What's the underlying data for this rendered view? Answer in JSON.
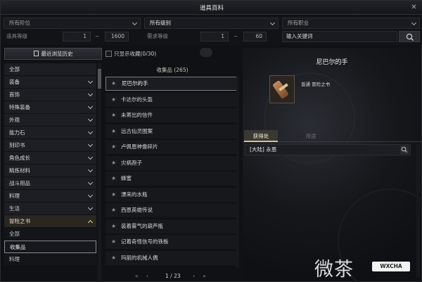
{
  "window": {
    "title": "道具百科"
  },
  "filters": {
    "part": "所有阶位",
    "grade": "所有级别",
    "job": "所有职业",
    "item_level_label": "道具等级",
    "item_level_min": "1",
    "item_level_max": "1600",
    "req_level_label": "需求等级",
    "req_level_min": "1",
    "req_level_max": "60",
    "range_sep": "~",
    "keyword_placeholder": "输入关键词"
  },
  "sidebar": {
    "recent_label": "最近浏览历史",
    "categories": [
      {
        "label": "全部"
      },
      {
        "label": "装备"
      },
      {
        "label": "首饰"
      },
      {
        "label": "特殊装备"
      },
      {
        "label": "外观"
      },
      {
        "label": "能力石"
      },
      {
        "label": "刻印书"
      },
      {
        "label": "角色成长"
      },
      {
        "label": "精炼材料"
      },
      {
        "label": "战斗用品"
      },
      {
        "label": "料理"
      },
      {
        "label": "生活"
      },
      {
        "label": "冒险之书"
      }
    ],
    "subcategories": [
      {
        "label": "全部"
      },
      {
        "label": "收集品"
      },
      {
        "label": "料理"
      }
    ]
  },
  "list": {
    "favorites_only_label": "只显示收藏(0/30)",
    "header": "收集品 (265)",
    "items": [
      {
        "name": "尼巴尔的手"
      },
      {
        "name": "卡达尔的头盔"
      },
      {
        "name": "未寄出的信件"
      },
      {
        "name": "远古仙灵图案"
      },
      {
        "name": "卢佩恩神像碎片"
      },
      {
        "name": "灾祸孢子"
      },
      {
        "name": "蜂蜜"
      },
      {
        "name": "漂来的水瓶"
      },
      {
        "name": "西恩英雄传说"
      },
      {
        "name": "装着雾气的葫芦瓶"
      },
      {
        "name": "记着奇怪信号的铁板"
      },
      {
        "name": "玛丽的机械人偶"
      }
    ],
    "page": "1 / 23",
    "nav": {
      "first": "«",
      "prev": "‹",
      "next": "›",
      "last": "»"
    }
  },
  "detail": {
    "name": "尼巴尔的手",
    "grade_type": "普通 冒险之书",
    "tabs": [
      {
        "label": "获得处"
      },
      {
        "label": "用途"
      }
    ],
    "sources": [
      {
        "label": "[大陆] 永恩"
      }
    ]
  },
  "watermark": {
    "text": "微茶",
    "tag": "WXCHA"
  }
}
